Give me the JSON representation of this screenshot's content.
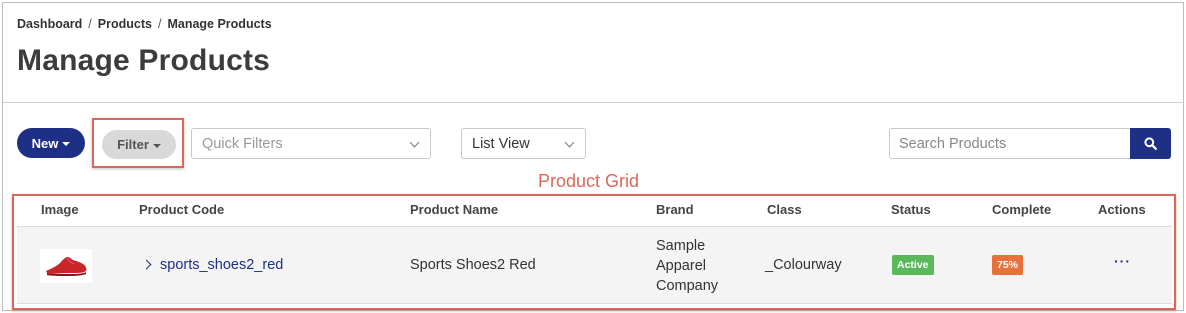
{
  "breadcrumb": [
    "Dashboard",
    "Products",
    "Manage Products"
  ],
  "breadcrumb_separator": "/",
  "page_title": "Manage Products",
  "toolbar": {
    "new_label": "New",
    "filter_label": "Filter",
    "quick_filters_placeholder": "Quick Filters",
    "view_select_value": "List View",
    "search_placeholder": "Search Products",
    "search_icon": "search-icon"
  },
  "annotation_label": "Product Grid",
  "grid": {
    "columns": [
      "Image",
      "Product Code",
      "Product Name",
      "Brand",
      "Class",
      "Status",
      "Complete",
      "Actions"
    ],
    "rows": [
      {
        "image": "red-shoe-thumbnail",
        "product_code": "sports_shoes2_red",
        "product_name": "Sports Shoes2 Red",
        "brand": "Sample Apparel Company",
        "class": "_Colourway",
        "status": "Active",
        "complete": "75%",
        "actions": "···"
      }
    ]
  },
  "colors": {
    "primary": "#1e2f86",
    "annotation": "#d9685a",
    "status_active": "#5cb85c",
    "complete_badge": "#e8703a"
  }
}
